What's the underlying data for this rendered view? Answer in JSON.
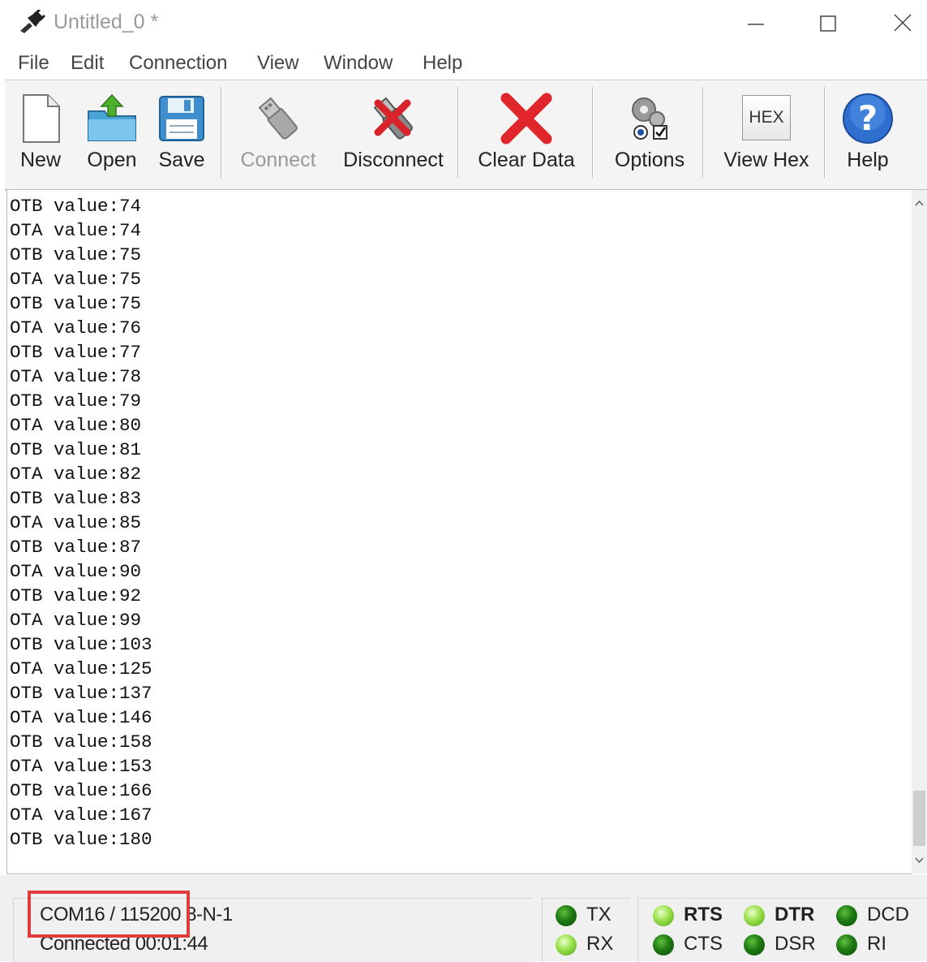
{
  "window": {
    "title": "Untitled_0 *"
  },
  "menu": [
    "File",
    "Edit",
    "Connection",
    "View",
    "Window",
    "Help"
  ],
  "toolbar": {
    "new_label": "New",
    "open_label": "Open",
    "save_label": "Save",
    "connect_label": "Connect",
    "disconnect_label": "Disconnect",
    "clear_label": "Clear Data",
    "options_label": "Options",
    "viewhex_label": "View Hex",
    "hex_icon_text": "HEX",
    "help_label": "Help"
  },
  "terminal": {
    "lines": [
      "OTB value:74",
      "OTA value:74",
      "OTB value:75",
      "OTA value:75",
      "OTB value:75",
      "OTA value:76",
      "OTB value:77",
      "OTA value:78",
      "OTB value:79",
      "OTA value:80",
      "OTB value:81",
      "OTA value:82",
      "OTB value:83",
      "OTA value:85",
      "OTB value:87",
      "OTA value:90",
      "OTB value:92",
      "OTA value:99",
      "OTB value:103",
      "OTA value:125",
      "OTB value:137",
      "OTA value:146",
      "OTB value:158",
      "OTA value:153",
      "OTB value:166",
      "OTA value:167",
      "OTB value:180"
    ]
  },
  "status": {
    "port": "COM16 / 115200 8-N-1",
    "connection": "Connected 00:01:44"
  },
  "leds": {
    "tx": "TX",
    "rx": "RX",
    "rts": "RTS",
    "cts": "CTS",
    "dtr": "DTR",
    "dsr": "DSR",
    "dcd": "DCD",
    "ri": "RI"
  },
  "colors": {
    "highlight": "#e03c3c",
    "led_on": "#98e04a",
    "led_off": "#1e7a12"
  }
}
